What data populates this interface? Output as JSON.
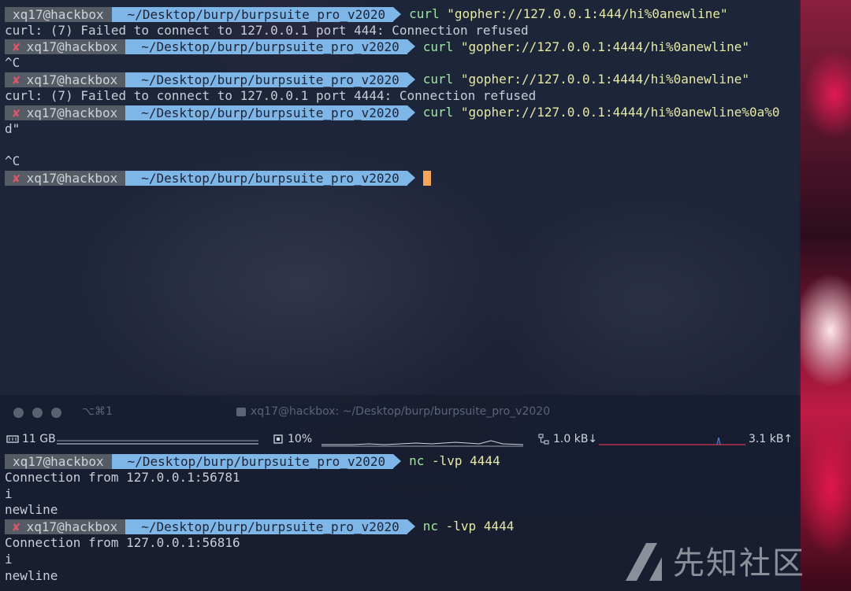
{
  "prompt": {
    "user": "xq17@hackbox",
    "path_v": "~/Desktop/burp/burpsuite_pro_v2020",
    "error_mark": "✘"
  },
  "top_pane": {
    "lines": [
      {
        "kind": "prompt",
        "error": false,
        "cmd_bin": "curl",
        "cmd_args": " \"gopher://127.0.0.1:444/hi%0anewline\""
      },
      {
        "kind": "output",
        "text": "curl: (7) Failed to connect to 127.0.0.1 port 444: Connection refused"
      },
      {
        "kind": "prompt",
        "error": true,
        "cmd_bin": "curl",
        "cmd_args": " \"gopher://127.0.0.1:4444/hi%0anewline\""
      },
      {
        "kind": "output",
        "text": "^C"
      },
      {
        "kind": "prompt",
        "error": true,
        "cmd_bin": "curl",
        "cmd_args": " \"gopher://127.0.0.1:4444/hi%0anewline\""
      },
      {
        "kind": "output",
        "text": "curl: (7) Failed to connect to 127.0.0.1 port 4444: Connection refused"
      },
      {
        "kind": "prompt",
        "error": true,
        "cmd_bin": "curl",
        "cmd_args": " \"gopher://127.0.0.1:4444/hi%0anewline%0a%0"
      },
      {
        "kind": "output",
        "text": "d\""
      },
      {
        "kind": "output",
        "text": ""
      },
      {
        "kind": "output",
        "text": "^C"
      },
      {
        "kind": "prompt",
        "error": true,
        "cursor": true,
        "cmd_bin": "",
        "cmd_args": ""
      }
    ]
  },
  "bottom_pane": {
    "tab_shortcut": "⌥⌘1",
    "window_title": "xq17@hackbox: ~/Desktop/burp/burpsuite_pro_v2020",
    "status": {
      "mem": "11 GB",
      "cpu": "10%",
      "net_down": "1.0 kB↓",
      "net_up": "3.1 kB↑"
    },
    "lines": [
      {
        "kind": "prompt",
        "error": false,
        "cmd_bin": "nc",
        "cmd_args": " -lvp 4444"
      },
      {
        "kind": "output",
        "text": "Connection from 127.0.0.1:56781"
      },
      {
        "kind": "output",
        "text": "i"
      },
      {
        "kind": "output",
        "text": "newline"
      },
      {
        "kind": "prompt",
        "error": true,
        "cmd_bin": "nc",
        "cmd_args": " -lvp 4444"
      },
      {
        "kind": "output",
        "text": "Connection from 127.0.0.1:56816"
      },
      {
        "kind": "output",
        "text": "i"
      },
      {
        "kind": "output",
        "text": "newline"
      }
    ]
  },
  "watermark": "先知社区",
  "colors": {
    "prompt_user_bg": "#555c66",
    "prompt_path_bg": "#7eb6e8",
    "command": "#e7e9a4",
    "error": "#e0556a",
    "cursor": "#f4a55a"
  }
}
